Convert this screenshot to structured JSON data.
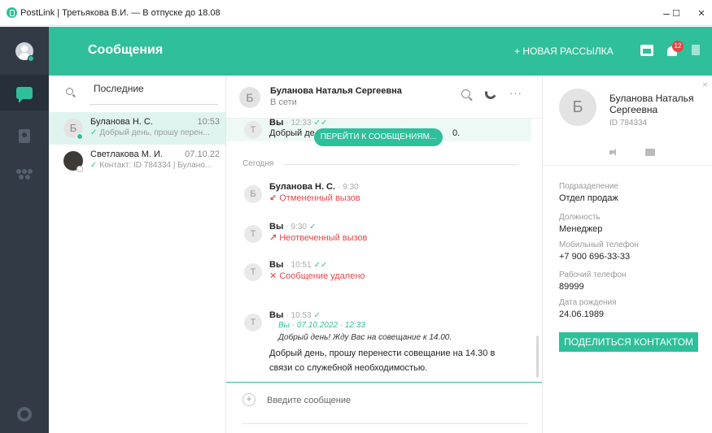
{
  "window": {
    "title": "PostLink  |  Третьякова В.И.  —  В отпуске до 18.08",
    "minimize": "–",
    "maximize": "☐",
    "close": "✕"
  },
  "colors": {
    "accent": "#2fbf9a",
    "rail": "#313a45",
    "missed": "#e64545"
  },
  "header": {
    "title": "Сообщения",
    "new_mailing": "+ НОВАЯ РАССЫЛКА",
    "notification_count": "12"
  },
  "chat_list": {
    "search_label": "Последние",
    "items": [
      {
        "initial": "Б",
        "name": "Буланова Н. С.",
        "time": "10:53",
        "check": "✓",
        "preview": "Добрый день, прошу перен..."
      },
      {
        "initial": "",
        "name": "Светлакова М. И.",
        "time": "07.10.22",
        "check": "✓",
        "preview": "Контакт: ID 784334 | Булано..."
      }
    ]
  },
  "conversation": {
    "initial": "Б",
    "name": "Буланова Наталья Сергеевна",
    "status": "В сети",
    "more": "···",
    "today_label": "Сегодня",
    "jump_button": "ПЕРЕЙТИ К СООБЩЕНИЯМ...",
    "messages": [
      {
        "avatar": "Т",
        "author": "Вы",
        "time": "· 12:33",
        "check": "✓✓",
        "text": "Добрый де",
        "text_tail": "0."
      },
      {
        "avatar": "Б",
        "author": "Буланова Н. С.",
        "time": "· 9:30",
        "arrow": "↙",
        "text": "Отмененный вызов"
      },
      {
        "avatar": "Т",
        "author": "Вы",
        "time": "· 9:30",
        "check": "✓",
        "arrow": "↗",
        "text": "Неотвеченный вызов"
      },
      {
        "avatar": "Т",
        "author": "Вы",
        "time": "· 10:51",
        "check": "✓✓",
        "arrow": "✕",
        "text": "Сообщение удалено"
      },
      {
        "avatar": "Т",
        "author": "Вы",
        "time": "· 10:53",
        "check": "✓",
        "quote_head": "Вы · 07.10.2022 · 12:33",
        "quote_text": "Добрый день! Жду Вас на совещание к 14.00.",
        "text": "Добрый день, прошу перенести совещание на 14.30 в связи со служебной необходимостью."
      }
    ],
    "composer_plus": "+",
    "composer_placeholder": "Введите сообщение"
  },
  "contact_panel": {
    "close": "×",
    "initial": "Б",
    "name": "Буланова Наталья Сергеевна",
    "id": "ID 784334",
    "fields": [
      {
        "label": "Подразделение",
        "value": "Отдел продаж"
      },
      {
        "label": "Должность",
        "value": "Менеджер"
      },
      {
        "label": "Мобильный телефон",
        "value": "+7  900 696-33-33"
      },
      {
        "label": "Рабочий телефон",
        "value": "89999"
      },
      {
        "label": "Дата рождения",
        "value": "24.06.1989"
      }
    ],
    "share_button": "ПОДЕЛИТЬСЯ КОНТАКТОМ"
  }
}
